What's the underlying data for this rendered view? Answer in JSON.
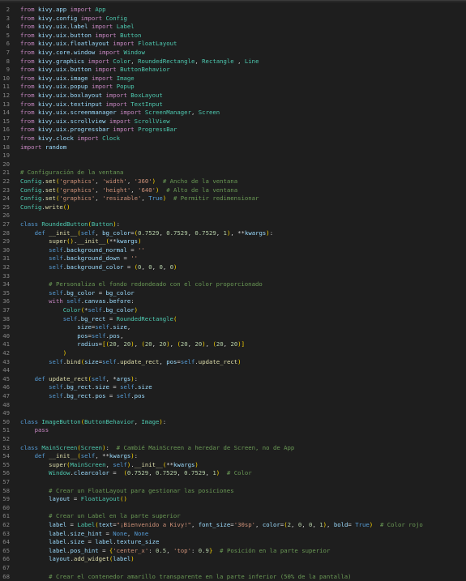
{
  "editor": {
    "lines": [
      {
        "n": "2",
        "t": "from kivy.app import App"
      },
      {
        "n": "3",
        "t": "from kivy.config import Config"
      },
      {
        "n": "4",
        "t": "from kivy.uix.label import Label"
      },
      {
        "n": "5",
        "t": "from kivy.uix.button import Button"
      },
      {
        "n": "6",
        "t": "from kivy.uix.floatlayout import FloatLayout"
      },
      {
        "n": "7",
        "t": "from kivy.core.window import Window"
      },
      {
        "n": "8",
        "t": "from kivy.graphics import Color, RoundedRectangle, Rectangle , Line"
      },
      {
        "n": "9",
        "t": "from kivy.uix.button import ButtonBehavior"
      },
      {
        "n": "10",
        "t": "from kivy.uix.image import Image"
      },
      {
        "n": "11",
        "t": "from kivy.uix.popup import Popup"
      },
      {
        "n": "12",
        "t": "from kivy.uix.boxlayout import BoxLayout"
      },
      {
        "n": "13",
        "t": "from kivy.uix.textinput import TextInput"
      },
      {
        "n": "14",
        "t": "from kivy.uix.screenmanager import ScreenManager, Screen"
      },
      {
        "n": "15",
        "t": "from kivy.uix.scrollview import ScrollView"
      },
      {
        "n": "16",
        "t": "from kivy.uix.progressbar import ProgressBar"
      },
      {
        "n": "17",
        "t": "from kivy.clock import Clock"
      },
      {
        "n": "18",
        "t": "import random"
      },
      {
        "n": "19",
        "t": ""
      },
      {
        "n": "20",
        "t": ""
      },
      {
        "n": "21",
        "t": "# Configuración de la ventana"
      },
      {
        "n": "22",
        "t": "Config.set('graphics', 'width', '360')  # Ancho de la ventana"
      },
      {
        "n": "23",
        "t": "Config.set('graphics', 'height', '640')  # Alto de la ventana"
      },
      {
        "n": "24",
        "t": "Config.set('graphics', 'resizable', True)  # Permitir redimensionar"
      },
      {
        "n": "25",
        "t": "Config.write()"
      },
      {
        "n": "26",
        "t": ""
      },
      {
        "n": "27",
        "t": "class RoundedButton(Button):"
      },
      {
        "n": "28",
        "t": "    def __init__(self, bg_color=(0.7529, 0.7529, 0.7529, 1), **kwargs):"
      },
      {
        "n": "29",
        "t": "        super().__init__(**kwargs)"
      },
      {
        "n": "30",
        "t": "        self.background_normal = ''"
      },
      {
        "n": "31",
        "t": "        self.background_down = ''"
      },
      {
        "n": "32",
        "t": "        self.background_color = (0, 0, 0, 0)"
      },
      {
        "n": "33",
        "t": ""
      },
      {
        "n": "34",
        "t": "        # Personaliza el fondo redondeado con el color proporcionado"
      },
      {
        "n": "35",
        "t": "        self.bg_color = bg_color"
      },
      {
        "n": "36",
        "t": "        with self.canvas.before:"
      },
      {
        "n": "37",
        "t": "            Color(*self.bg_color)"
      },
      {
        "n": "38",
        "t": "            self.bg_rect = RoundedRectangle("
      },
      {
        "n": "39",
        "t": "                size=self.size,"
      },
      {
        "n": "40",
        "t": "                pos=self.pos,"
      },
      {
        "n": "41",
        "t": "                radius=[(20, 20), (20, 20), (20, 20), (20, 20)]"
      },
      {
        "n": "42",
        "t": "            )"
      },
      {
        "n": "43",
        "t": "        self.bind(size=self.update_rect, pos=self.update_rect)"
      },
      {
        "n": "44",
        "t": ""
      },
      {
        "n": "45",
        "t": "    def update_rect(self, *args):"
      },
      {
        "n": "46",
        "t": "        self.bg_rect.size = self.size"
      },
      {
        "n": "47",
        "t": "        self.bg_rect.pos = self.pos"
      },
      {
        "n": "48",
        "t": ""
      },
      {
        "n": "49",
        "t": ""
      },
      {
        "n": "50",
        "t": "class ImageButton(ButtonBehavior, Image):"
      },
      {
        "n": "51",
        "t": "    pass"
      },
      {
        "n": "52",
        "t": ""
      },
      {
        "n": "53",
        "t": "class MainScreen(Screen):  # Cambié MainScreen a heredar de Screen, no de App"
      },
      {
        "n": "54",
        "t": "    def __init__(self, **kwargs):"
      },
      {
        "n": "55",
        "t": "        super(MainScreen, self).__init__(**kwargs)"
      },
      {
        "n": "56",
        "t": "        Window.clearcolor =  (0.7529, 0.7529, 0.7529, 1)  # Color"
      },
      {
        "n": "57",
        "t": ""
      },
      {
        "n": "58",
        "t": "        # Crear un FloatLayout para gestionar las posiciones"
      },
      {
        "n": "59",
        "t": "        layout = FloatLayout()"
      },
      {
        "n": "60",
        "t": ""
      },
      {
        "n": "61",
        "t": "        # Crear un Label en la parte superior"
      },
      {
        "n": "62",
        "t": "        label = Label(text=\"¡Bienvenido a Kivy!\", font_size='30sp', color=(2, 0, 0, 1), bold= True)  # Color rojo"
      },
      {
        "n": "63",
        "t": "        label.size_hint = None, None"
      },
      {
        "n": "64",
        "t": "        label.size = label.texture_size"
      },
      {
        "n": "65",
        "t": "        label.pos_hint = {'center_x': 0.5, 'top': 0.9}  # Posición en la parte superior"
      },
      {
        "n": "66",
        "t": "        layout.add_widget(label)"
      },
      {
        "n": "67",
        "t": ""
      },
      {
        "n": "68",
        "t": "        # Crear el contenedor amarillo transparente en la parte inferior (50% de la pantalla)"
      }
    ]
  }
}
